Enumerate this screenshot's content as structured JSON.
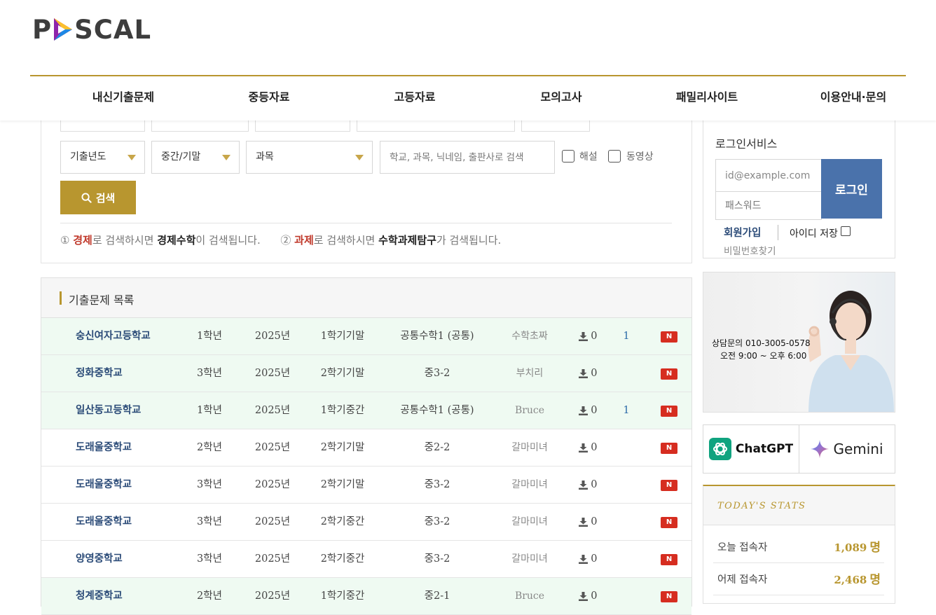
{
  "header": {
    "logo": {
      "prefix": "P",
      "suffix": "SCAL"
    },
    "nav": [
      "내신기출문제",
      "중등자료",
      "고등자료",
      "모의고사",
      "패밀리사이트",
      "이용안내·문의"
    ]
  },
  "search": {
    "selects": [
      "기출년도",
      "중간/기말",
      "과목"
    ],
    "placeholder": "학교, 과목, 닉네임, 출판사로 검색",
    "checkboxes": [
      "해설",
      "동영상"
    ],
    "button_label": "검색",
    "hint": {
      "n1": "①",
      "w1": "경제",
      "t1": "로 검색하시면",
      "r1": "경제수학",
      "t2": "이 검색됩니다.",
      "n2": "②",
      "w2": "과제",
      "t3": "로 검색하시면",
      "r2": "수학과제탐구",
      "t4": "가 검색됩니다."
    }
  },
  "list": {
    "title": "기출문제 목록",
    "rows": [
      {
        "school": "숭신여자고등학교",
        "grade": "1학년",
        "year": "2025년",
        "term": "1학기기말",
        "subject": "공통수학1 (공통)",
        "user": "수학초짜",
        "downloads": "0",
        "comments": "1",
        "badge": "N",
        "highlight": true
      },
      {
        "school": "정화중학교",
        "grade": "3학년",
        "year": "2025년",
        "term": "2학기기말",
        "subject": "중3-2",
        "user": "부치리",
        "downloads": "0",
        "comments": "",
        "badge": "N",
        "highlight": true
      },
      {
        "school": "일산동고등학교",
        "grade": "1학년",
        "year": "2025년",
        "term": "1학기중간",
        "subject": "공통수학1 (공통)",
        "user": "Bruce",
        "downloads": "0",
        "comments": "1",
        "badge": "N",
        "highlight": true
      },
      {
        "school": "도래울중학교",
        "grade": "2학년",
        "year": "2025년",
        "term": "2학기기말",
        "subject": "중2-2",
        "user": "갈마미녀",
        "downloads": "0",
        "comments": "",
        "badge": "N",
        "highlight": false
      },
      {
        "school": "도래울중학교",
        "grade": "3학년",
        "year": "2025년",
        "term": "2학기기말",
        "subject": "중3-2",
        "user": "갈마미녀",
        "downloads": "0",
        "comments": "",
        "badge": "N",
        "highlight": false
      },
      {
        "school": "도래울중학교",
        "grade": "3학년",
        "year": "2025년",
        "term": "2학기중간",
        "subject": "중3-2",
        "user": "갈마미녀",
        "downloads": "0",
        "comments": "",
        "badge": "N",
        "highlight": false
      },
      {
        "school": "양영중학교",
        "grade": "3학년",
        "year": "2025년",
        "term": "2학기중간",
        "subject": "중3-2",
        "user": "갈마미녀",
        "downloads": "0",
        "comments": "",
        "badge": "N",
        "highlight": false
      },
      {
        "school": "청계중학교",
        "grade": "2학년",
        "year": "2025년",
        "term": "1학기중간",
        "subject": "중2-1",
        "user": "Bruce",
        "downloads": "0",
        "comments": "",
        "badge": "N",
        "highlight": true
      }
    ]
  },
  "login": {
    "title": "로그인서비스",
    "id_placeholder": "id@example.com",
    "pw_placeholder": "패스워드",
    "button_label": "로그인",
    "signup": "회원가입",
    "remember": "아이디 저장",
    "find_password": "비밀번호찾기"
  },
  "banner": {
    "line1": "상담문의 010-3005-0578",
    "line2": "오전 9:00 ~ 오후 6:00"
  },
  "ai": {
    "chatgpt": "ChatGPT",
    "gemini": "Gemini"
  },
  "stats": {
    "title": "TODAY'S STATS",
    "rows": [
      {
        "label": "오늘 접속자",
        "value": "1,089",
        "unit": "명"
      },
      {
        "label": "어제 접속자",
        "value": "2,468",
        "unit": "명"
      }
    ]
  },
  "colors": {
    "accent": "#b8962f",
    "navy": "#2b4b78",
    "login_blue": "#4a72ab",
    "badge_red": "#d62d20",
    "row_highlight": "#effaf2"
  }
}
